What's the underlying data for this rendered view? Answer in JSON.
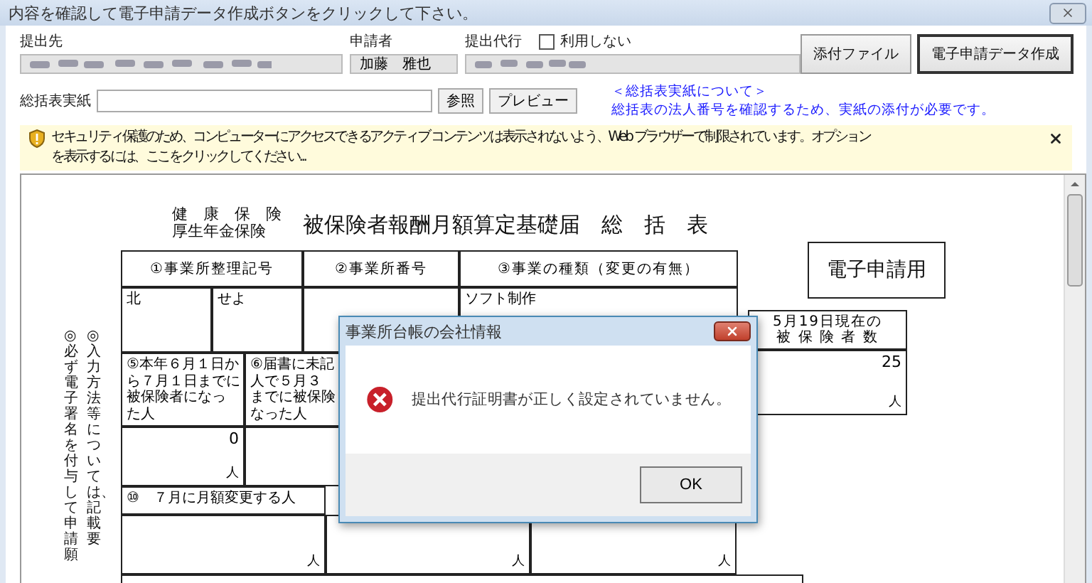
{
  "window": {
    "title": "内容を確認して電子申請データ作成ボタンをクリックして下さい。"
  },
  "header": {
    "submit_to": {
      "label": "提出先"
    },
    "applicant": {
      "label": "申請者",
      "value": "加藤　雅也"
    },
    "proxy": {
      "label": "提出代行",
      "checkbox_label": "利用しない",
      "checked": false
    },
    "buttons": [
      {
        "label": "添付ファイル",
        "default": false
      },
      {
        "label": "電子申請データ作成",
        "default": true
      }
    ]
  },
  "attachment": {
    "label": "総括表実紙",
    "browse": "参照",
    "preview": "プレビュー",
    "link": "＜総括表実紙について＞",
    "note": "総括表の法人番号を確認するため、実紙の添付が必要です。"
  },
  "security_bar": {
    "lines": [
      "セキュリティ保護のため、コンピューターにアクセスできるアクティブ コンテンツは表示されないよう、Web ブラウザーで制限されています。オプション",
      "を表示するには、ここをクリックしてください..."
    ]
  },
  "document": {
    "title_left": [
      "健　康　保　険",
      "厚生年金保険"
    ],
    "title": "被保険者報酬月額算定基礎届　総　括　表",
    "stamp": "電子申請用",
    "side_notes": [
      "◎必ず電子署名を付与して申請願",
      "◎入力方法等については、記載要"
    ],
    "headcount": {
      "lines": [
        "5月19日現在の",
        "被 保 険 者 数"
      ],
      "value": "25",
      "unit": "人"
    },
    "cells": [
      {
        "kind": "header",
        "lines": [
          "①事業所整理記号"
        ]
      },
      {
        "kind": "header",
        "lines": [
          "②事業所番号"
        ]
      },
      {
        "kind": "header",
        "lines": [
          "③事業の種類（変更の有無）"
        ]
      },
      {
        "kind": "value",
        "lines": [
          "北"
        ]
      },
      {
        "kind": "value",
        "lines": [
          "せよ"
        ]
      },
      {
        "kind": "value",
        "lines": [
          "ソフト制作"
        ]
      },
      {
        "kind": "label",
        "lines": [
          "⑤本年６月１日か",
          "ら７月１日までに",
          "被保険者になっ",
          "た人"
        ]
      },
      {
        "kind": "label",
        "lines": [
          "⑥届書に未記",
          "人で５月３",
          "までに被保険",
          "なった人"
        ]
      },
      {
        "kind": "number",
        "lines": [
          "0"
        ]
      },
      {
        "kind": "unit",
        "lines": [
          "人"
        ]
      },
      {
        "kind": "label",
        "lines": [
          "⑩　７月に月額変更する人"
        ]
      },
      {
        "kind": "unit",
        "lines": [
          "人"
        ]
      },
      {
        "kind": "unit",
        "lines": [
          "人"
        ]
      },
      {
        "kind": "unit",
        "lines": [
          "人"
        ]
      }
    ]
  },
  "dialog": {
    "title": "事業所台帳の会社情報",
    "message": "提出代行証明書が正しく設定されていません。",
    "button": "OK"
  }
}
